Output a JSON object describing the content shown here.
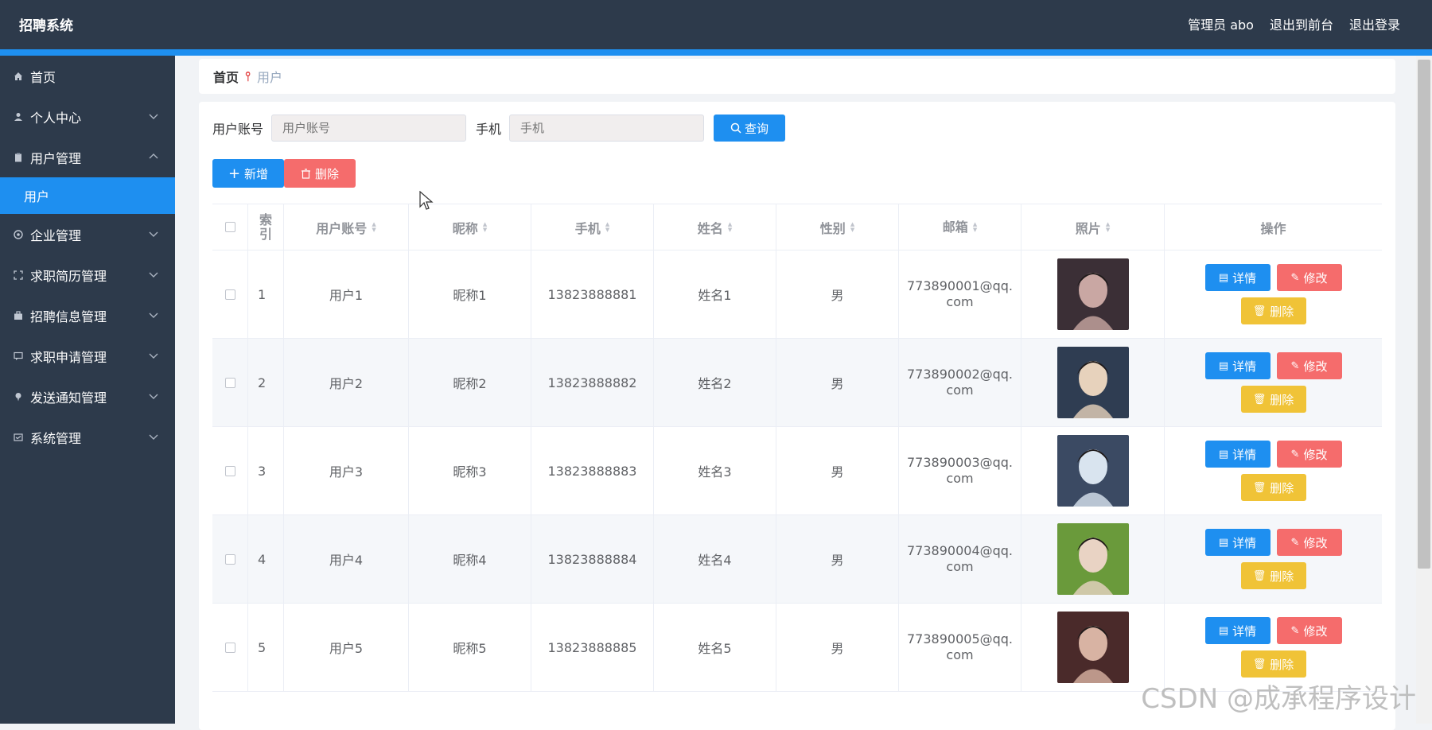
{
  "header": {
    "title": "招聘系统",
    "user": "管理员 abo",
    "to_front": "退出到前台",
    "logout": "退出登录"
  },
  "sidebar": {
    "items": [
      {
        "label": "首页",
        "icon": "home-icon"
      },
      {
        "label": "个人中心",
        "icon": "user-icon"
      },
      {
        "label": "用户管理",
        "icon": "clipboard-icon",
        "expanded": true,
        "children": [
          {
            "label": "用户",
            "active": true
          }
        ]
      },
      {
        "label": "企业管理",
        "icon": "building-icon"
      },
      {
        "label": "求职简历管理",
        "icon": "frame-icon"
      },
      {
        "label": "招聘信息管理",
        "icon": "briefcase-icon"
      },
      {
        "label": "求职申请管理",
        "icon": "chat-icon"
      },
      {
        "label": "发送通知管理",
        "icon": "pin-icon"
      },
      {
        "label": "系统管理",
        "icon": "settings-icon"
      }
    ]
  },
  "breadcrumb": {
    "home": "首页",
    "separator": "⫯",
    "current": "用户"
  },
  "search": {
    "account_label": "用户账号",
    "account_placeholder": "用户账号",
    "phone_label": "手机",
    "phone_placeholder": "手机",
    "button": "查询"
  },
  "actions": {
    "add": "新增",
    "delete": "删除"
  },
  "table": {
    "headers": {
      "index": "索引",
      "account": "用户账号",
      "nickname": "昵称",
      "phone": "手机",
      "name": "姓名",
      "gender": "性别",
      "email": "邮箱",
      "photo": "照片",
      "ops": "操作"
    },
    "rows": [
      {
        "index": "1",
        "account": "用户1",
        "nickname": "昵称1",
        "phone": "13823888881",
        "name": "姓名1",
        "gender": "男",
        "email": "773890001@qq.com"
      },
      {
        "index": "2",
        "account": "用户2",
        "nickname": "昵称2",
        "phone": "13823888882",
        "name": "姓名2",
        "gender": "男",
        "email": "773890002@qq.com"
      },
      {
        "index": "3",
        "account": "用户3",
        "nickname": "昵称3",
        "phone": "13823888883",
        "name": "姓名3",
        "gender": "男",
        "email": "773890003@qq.com"
      },
      {
        "index": "4",
        "account": "用户4",
        "nickname": "昵称4",
        "phone": "13823888884",
        "name": "姓名4",
        "gender": "男",
        "email": "773890004@qq.com"
      },
      {
        "index": "5",
        "account": "用户5",
        "nickname": "昵称5",
        "phone": "13823888885",
        "name": "姓名5",
        "gender": "男",
        "email": "773890005@qq.com"
      }
    ],
    "row_buttons": {
      "detail": "详情",
      "edit": "修改",
      "delete": "删除"
    }
  },
  "watermark": "CSDN @成承程序设计",
  "colors": {
    "topbar": "#2d3a4b",
    "accent": "#1e8ff0",
    "danger": "#f56c6c",
    "warning": "#f0c337"
  }
}
